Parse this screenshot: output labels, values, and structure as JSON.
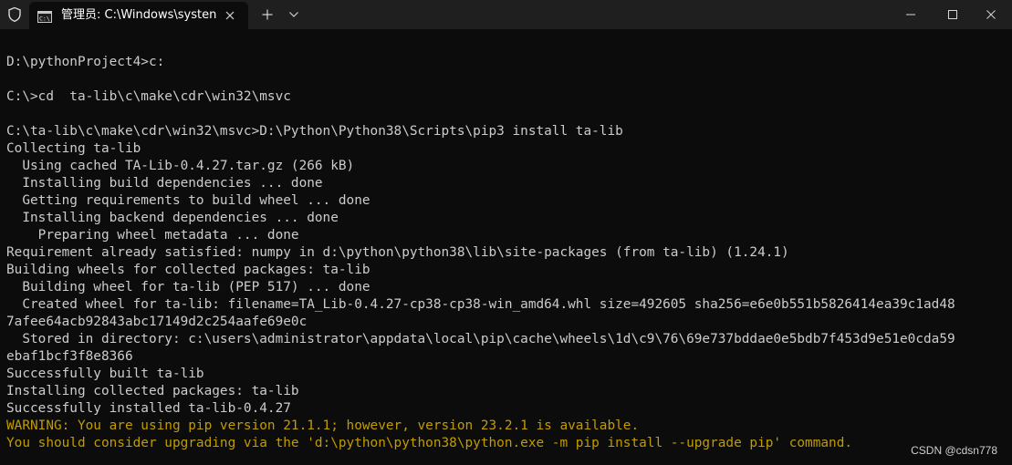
{
  "window": {
    "title": "管理员: C:\\Windows\\systen",
    "icons": {
      "shield": "shield-icon",
      "cmd": "terminal-icon",
      "close_tab": "close-icon",
      "new_tab": "plus-icon",
      "dropdown": "chevron-down-icon",
      "minimize": "minimize-icon",
      "maximize": "maximize-icon",
      "close": "close-icon"
    }
  },
  "colors": {
    "background": "#0c0c0c",
    "titlebar": "#1f1f1f",
    "text": "#cccccc",
    "warning": "#c19c00"
  },
  "terminal": {
    "lines": [
      {
        "text": "D:\\pythonProject4>c:",
        "style": "normal"
      },
      {
        "text": "",
        "style": "normal"
      },
      {
        "text": "C:\\>cd  ta-lib\\c\\make\\cdr\\win32\\msvc",
        "style": "normal"
      },
      {
        "text": "",
        "style": "normal"
      },
      {
        "text": "C:\\ta-lib\\c\\make\\cdr\\win32\\msvc>D:\\Python\\Python38\\Scripts\\pip3 install ta-lib",
        "style": "normal"
      },
      {
        "text": "Collecting ta-lib",
        "style": "normal"
      },
      {
        "text": "  Using cached TA-Lib-0.4.27.tar.gz (266 kB)",
        "style": "normal"
      },
      {
        "text": "  Installing build dependencies ... done",
        "style": "normal"
      },
      {
        "text": "  Getting requirements to build wheel ... done",
        "style": "normal"
      },
      {
        "text": "  Installing backend dependencies ... done",
        "style": "normal"
      },
      {
        "text": "    Preparing wheel metadata ... done",
        "style": "normal"
      },
      {
        "text": "Requirement already satisfied: numpy in d:\\python\\python38\\lib\\site-packages (from ta-lib) (1.24.1)",
        "style": "normal"
      },
      {
        "text": "Building wheels for collected packages: ta-lib",
        "style": "normal"
      },
      {
        "text": "  Building wheel for ta-lib (PEP 517) ... done",
        "style": "normal"
      },
      {
        "text": "  Created wheel for ta-lib: filename=TA_Lib-0.4.27-cp38-cp38-win_amd64.whl size=492605 sha256=e6e0b551b5826414ea39c1ad48",
        "style": "normal"
      },
      {
        "text": "7afee64acb92843abc17149d2c254aafe69e0c",
        "style": "normal"
      },
      {
        "text": "  Stored in directory: c:\\users\\administrator\\appdata\\local\\pip\\cache\\wheels\\1d\\c9\\76\\69e737bddae0e5bdb7f453d9e51e0cda59",
        "style": "normal"
      },
      {
        "text": "ebaf1bcf3f8e8366",
        "style": "normal"
      },
      {
        "text": "Successfully built ta-lib",
        "style": "normal"
      },
      {
        "text": "Installing collected packages: ta-lib",
        "style": "normal"
      },
      {
        "text": "Successfully installed ta-lib-0.4.27",
        "style": "normal"
      },
      {
        "text": "WARNING: You are using pip version 21.1.1; however, version 23.2.1 is available.",
        "style": "warn"
      },
      {
        "text": "You should consider upgrading via the 'd:\\python\\python38\\python.exe -m pip install --upgrade pip' command.",
        "style": "warn"
      }
    ]
  },
  "watermark": "CSDN @cdsn778"
}
